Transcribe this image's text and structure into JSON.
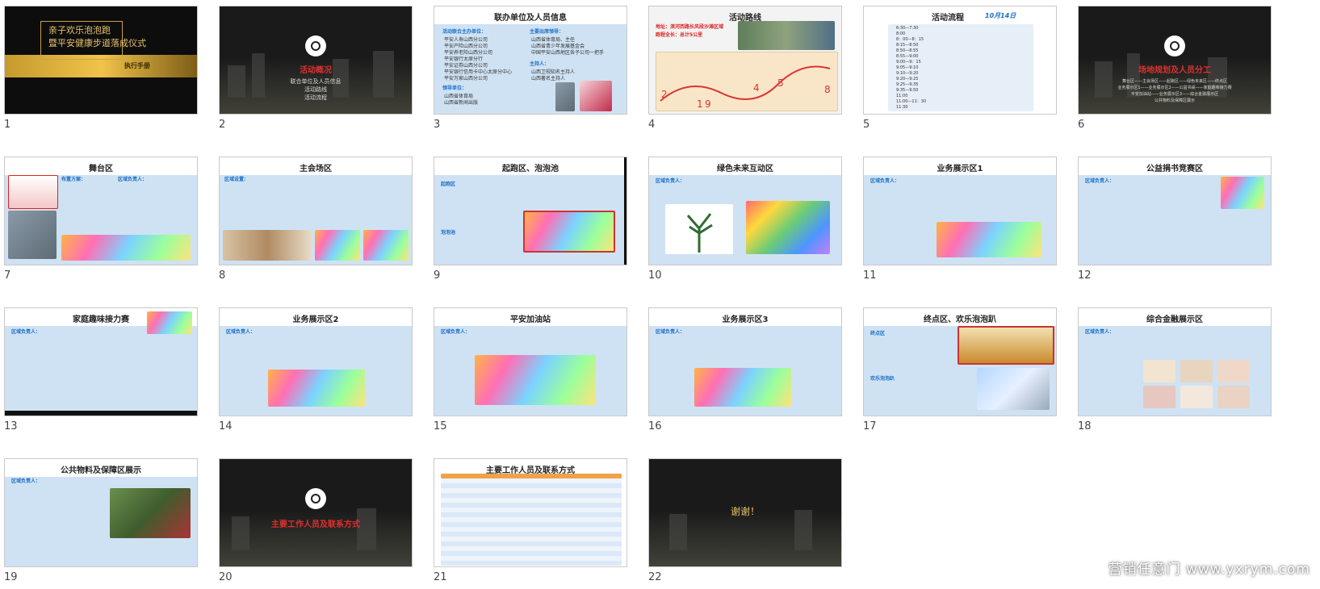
{
  "slides": [
    {
      "num": "1",
      "title_line1": "亲子欢乐泡泡跑",
      "title_line2": "暨平安健康步道落成仪式",
      "subtitle": "执行手册"
    },
    {
      "num": "2",
      "red": "活动概况",
      "lines": [
        "联合单位及人员信息",
        "活动路线",
        "活动流程"
      ]
    },
    {
      "num": "3",
      "title": "联办单位及人员信息",
      "left_head": "活动联合主办单位：",
      "left_items": [
        "平安人寿山西分公司",
        "平安产险山西分公司",
        "平安养老险山西分公司",
        "平安银行太原分行",
        "平安证券山西分公司",
        "平安银行信用卡中心太原分中心",
        "平安万家山西分公司"
      ],
      "right_head": "主要出席领导：",
      "right_items": [
        "山西省体育局、主任",
        "山西省青少年发展基金会",
        "中国平安山西地区各子公司一把手"
      ],
      "host_head": "主持人：",
      "host_items": [
        "山西卫视知名主持人",
        "山西著名主持人"
      ],
      "guard_head": "领导单位：",
      "guard_items": [
        "山西省体育局",
        "山西省新闻出版"
      ]
    },
    {
      "num": "4",
      "title": "活动路线",
      "l1": "地址：滨河西路长风段沙滩区域",
      "l2": "跑程全长：总计5公里"
    },
    {
      "num": "5",
      "title": "活动流程",
      "date": "10月14日",
      "rows": [
        "6:30—7:30",
        "8:00",
        "8：00—8：15",
        "8:15—8:50",
        "8:50—8:55",
        "8:55—9:00",
        "9:00—9：15",
        "9:05—9:10",
        "9:10—9:20",
        "9:20—9:25",
        "9:25—9:35",
        "9:35—9:50",
        "11:00",
        "11:00—11：30",
        "11:30"
      ]
    },
    {
      "num": "6",
      "red": "场地规划及人员分工",
      "lines": [
        "舞台区——主会场区——起跑区——绿色未来区——终点区",
        "业务展示区1——业务展示区2——公益书桌——家庭趣味接力赛",
        "平安加油站——业务展示区3——综合金融展示区",
        "公共物料及保障区展示"
      ]
    },
    {
      "num": "7",
      "title": "舞台区",
      "head": "布置方案：",
      "area": "区域负责人："
    },
    {
      "num": "8",
      "title": "主会场区",
      "head": "区域设置："
    },
    {
      "num": "9",
      "title": "起跑区、泡泡池",
      "head": "起跑区",
      "head2": "泡泡池"
    },
    {
      "num": "10",
      "title": "绿色未来互动区",
      "head": "区域负责人："
    },
    {
      "num": "11",
      "title": "业务展示区1",
      "head": "区域负责人："
    },
    {
      "num": "12",
      "title": "公益捐书竞赛区",
      "head": "区域负责人："
    },
    {
      "num": "13",
      "title": "家庭趣味接力赛",
      "head": "区域负责人："
    },
    {
      "num": "14",
      "title": "业务展示区2",
      "head": "区域负责人："
    },
    {
      "num": "15",
      "title": "平安加油站",
      "head": "区域负责人："
    },
    {
      "num": "16",
      "title": "业务展示区3",
      "head": "区域负责人："
    },
    {
      "num": "17",
      "title": "终点区、欢乐泡泡趴",
      "head": "终点区",
      "head2": "欢乐泡泡趴"
    },
    {
      "num": "18",
      "title": "综合金融展示区",
      "head": "区域负责人："
    },
    {
      "num": "19",
      "title": "公共物料及保障区展示",
      "head": "区域负责人："
    },
    {
      "num": "20",
      "red": "主要工作人员及联系方式"
    },
    {
      "num": "21",
      "title": "主要工作人员及联系方式"
    },
    {
      "num": "22",
      "thanks": "谢谢！"
    }
  ],
  "watermark": "营销任意门 www.yxrym.com"
}
